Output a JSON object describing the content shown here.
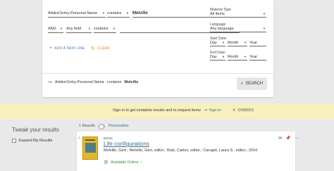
{
  "search": {
    "row1": {
      "field": "Added Entry-Personal Name",
      "operator": "contains",
      "value": "Melville"
    },
    "row2": {
      "bool": "AND",
      "field": "Any field",
      "operator": "contains",
      "value": ""
    },
    "add_line": "ADD A NEW LINE",
    "clear": "CLEAR",
    "material_type": {
      "label": "Material Type",
      "value": "All items"
    },
    "language": {
      "label": "Language",
      "value": "Any language"
    },
    "start_date": {
      "label": "Start Date:",
      "day": "Day",
      "month": "Month",
      "year": "Year"
    },
    "end_date": {
      "label": "End Date:",
      "day": "Day",
      "month": "Month",
      "year": "Year"
    },
    "summary": {
      "field": "Added Entry-Personal Name",
      "op": "contains",
      "value": "Melville"
    },
    "search_button": "SEARCH"
  },
  "banner": {
    "message": "Sign in to get complete results and to request items",
    "sign_in": "Sign in",
    "dismiss": "DISMISS"
  },
  "facets": {
    "title": "Tweak your results",
    "expand_label": "Expand My Results"
  },
  "results": {
    "count_text": "1 Results",
    "personalize": "Personalize",
    "items": [
      {
        "number": "1",
        "type": "BOOK",
        "title": "Life configurations",
        "authors": "Melville, Gert.; Melville, Gert, editor.; Rutz, Carlos, editor.; Caruget, Laura S., editor.; 2014",
        "availability": "Available Online"
      }
    ]
  },
  "colors": {
    "accent": "#3b6e8f",
    "banner": "#f7f0bd",
    "available": "#3b8a3e",
    "clear": "#e08a00",
    "add": "#4a7fb5"
  }
}
